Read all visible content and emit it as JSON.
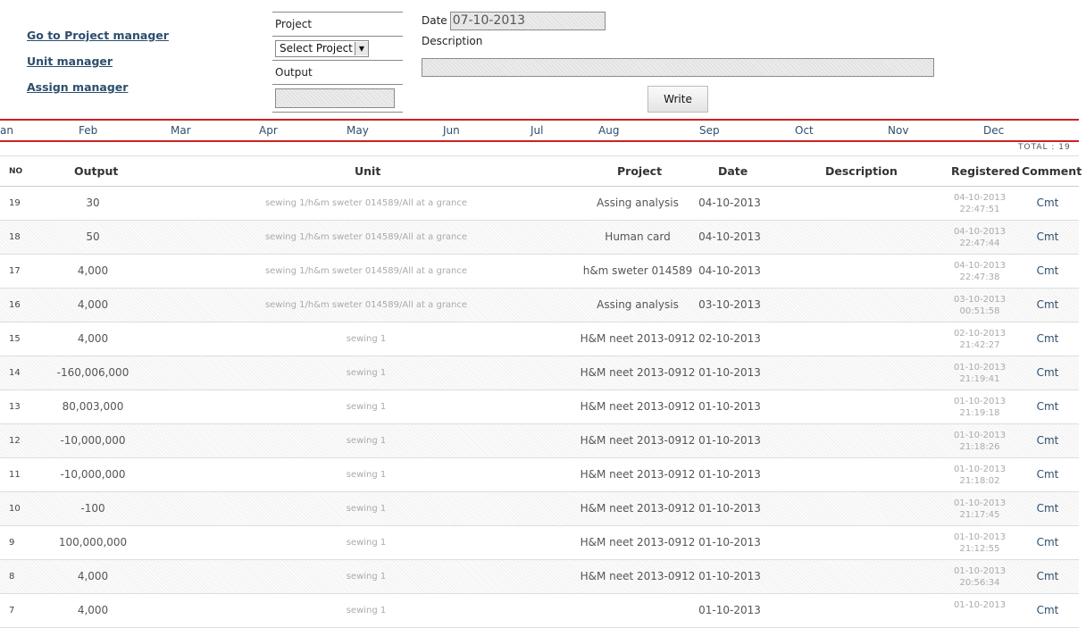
{
  "nav": {
    "project_manager": "Go to Project manager",
    "unit_manager": "Unit manager",
    "assign_manager": "Assign manager"
  },
  "form": {
    "project_label": "Project",
    "project_select": "Select Project",
    "output_label": "Output",
    "output_value": "",
    "date_label": "Date",
    "date_value": "07-10-2013",
    "description_label": "Description",
    "description_value": "",
    "write_button": "Write"
  },
  "months": [
    "an",
    "Feb",
    "Mar",
    "Apr",
    "May",
    "Jun",
    "Jul",
    "Aug",
    "Sep",
    "Oct",
    "Nov",
    "Dec"
  ],
  "total_label": "TOTAL :  19",
  "table": {
    "headers": {
      "no": "NO",
      "output": "Output",
      "unit": "Unit",
      "project": "Project",
      "date": "Date",
      "description": "Description",
      "registered": "Registered",
      "comment": "Comment"
    },
    "rows": [
      {
        "no": "19",
        "output": "30",
        "unit": "sewing 1/h&m sweter 014589/All at a grance",
        "project": "Assing analysis",
        "date": "04-10-2013",
        "description": "",
        "reg_date": "04-10-2013",
        "reg_time": "22:47:51",
        "cmt": "Cmt"
      },
      {
        "no": "18",
        "output": "50",
        "unit": "sewing 1/h&m sweter 014589/All at a grance",
        "project": "Human card",
        "date": "04-10-2013",
        "description": "",
        "reg_date": "04-10-2013",
        "reg_time": "22:47:44",
        "cmt": "Cmt"
      },
      {
        "no": "17",
        "output": "4,000",
        "unit": "sewing 1/h&m sweter 014589/All at a grance",
        "project": "h&m sweter 014589",
        "date": "04-10-2013",
        "description": "",
        "reg_date": "04-10-2013",
        "reg_time": "22:47:38",
        "cmt": "Cmt"
      },
      {
        "no": "16",
        "output": "4,000",
        "unit": "sewing 1/h&m sweter 014589/All at a grance",
        "project": "Assing analysis",
        "date": "03-10-2013",
        "description": "",
        "reg_date": "03-10-2013",
        "reg_time": "00:51:58",
        "cmt": "Cmt"
      },
      {
        "no": "15",
        "output": "4,000",
        "unit": "sewing 1",
        "project": "H&M neet 2013-0912",
        "date": "02-10-2013",
        "description": "",
        "reg_date": "02-10-2013",
        "reg_time": "21:42:27",
        "cmt": "Cmt"
      },
      {
        "no": "14",
        "output": "-160,006,000",
        "unit": "sewing 1",
        "project": "H&M neet 2013-0912",
        "date": "01-10-2013",
        "description": "",
        "reg_date": "01-10-2013",
        "reg_time": "21:19:41",
        "cmt": "Cmt"
      },
      {
        "no": "13",
        "output": "80,003,000",
        "unit": "sewing 1",
        "project": "H&M neet 2013-0912",
        "date": "01-10-2013",
        "description": "",
        "reg_date": "01-10-2013",
        "reg_time": "21:19:18",
        "cmt": "Cmt"
      },
      {
        "no": "12",
        "output": "-10,000,000",
        "unit": "sewing 1",
        "project": "H&M neet 2013-0912",
        "date": "01-10-2013",
        "description": "",
        "reg_date": "01-10-2013",
        "reg_time": "21:18:26",
        "cmt": "Cmt"
      },
      {
        "no": "11",
        "output": "-10,000,000",
        "unit": "sewing 1",
        "project": "H&M neet 2013-0912",
        "date": "01-10-2013",
        "description": "",
        "reg_date": "01-10-2013",
        "reg_time": "21:18:02",
        "cmt": "Cmt"
      },
      {
        "no": "10",
        "output": "-100",
        "unit": "sewing 1",
        "project": "H&M neet 2013-0912",
        "date": "01-10-2013",
        "description": "",
        "reg_date": "01-10-2013",
        "reg_time": "21:17:45",
        "cmt": "Cmt"
      },
      {
        "no": "9",
        "output": "100,000,000",
        "unit": "sewing 1",
        "project": "H&M neet 2013-0912",
        "date": "01-10-2013",
        "description": "",
        "reg_date": "01-10-2013",
        "reg_time": "21:12:55",
        "cmt": "Cmt"
      },
      {
        "no": "8",
        "output": "4,000",
        "unit": "sewing 1",
        "project": "H&M neet 2013-0912",
        "date": "01-10-2013",
        "description": "",
        "reg_date": "01-10-2013",
        "reg_time": "20:56:34",
        "cmt": "Cmt"
      },
      {
        "no": "7",
        "output": "4,000",
        "unit": "sewing 1",
        "project": "",
        "date": "01-10-2013",
        "description": "",
        "reg_date": "01-10-2013",
        "reg_time": "",
        "cmt": "Cmt"
      }
    ]
  }
}
